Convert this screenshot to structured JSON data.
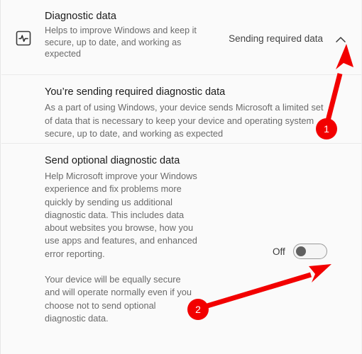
{
  "page": {
    "background_color": "#fafafa",
    "accent_color": "#f20000"
  },
  "header": {
    "icon": "pulse-activity-icon",
    "title": "Diagnostic data",
    "subtitle": "Helps to improve Windows and keep it secure, up to date, and working as expected",
    "status": "Sending required data",
    "chevron": "chevron-up-icon"
  },
  "required": {
    "title": "You’re sending required diagnostic data",
    "body": "As a part of using Windows, your device sends Microsoft a limited set of data that is necessary to keep your device and operating system secure, up to date, and working as expected"
  },
  "optional": {
    "title": "Send optional diagnostic data",
    "body": "Help Microsoft improve your Windows experience and fix problems more quickly by sending us additional diagnostic data. This includes data about websites you browse, how you use apps and features, and enhanced error reporting.",
    "note": "Your device will be equally secure and will operate normally even if you choose not to send optional diagnostic data.",
    "toggle": {
      "label": "Off",
      "state": "off"
    }
  },
  "annotations": {
    "badges": [
      {
        "label": "1"
      },
      {
        "label": "2"
      }
    ],
    "arrows": [
      {
        "name": "arrow-to-chevron"
      },
      {
        "name": "arrow-to-toggle"
      }
    ]
  }
}
